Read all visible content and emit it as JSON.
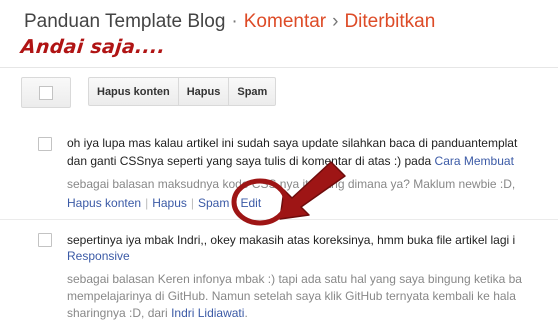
{
  "breadcrumb": {
    "root": "Panduan Template Blog",
    "sep": "·",
    "section": "Komentar",
    "sep2": "›",
    "current": "Diterbitkan"
  },
  "annotation_title": "Andai saja....",
  "toolbar": {
    "delete_content": "Hapus konten",
    "delete": "Hapus",
    "spam": "Spam"
  },
  "comments": [
    {
      "line1": "oh iya lupa mas kalau artikel ini sudah saya update silahkan baca di panduantemplat",
      "line2_text": "dan ganti CSSnya seperti yang saya tulis di komentar di atas :) pada ",
      "line2_link": "Cara Membuat",
      "reply_text": "sebagai balasan maksudnya kode CSS nya itu yang dimana ya? Maklum newbie :D,",
      "actions": [
        "Hapus konten",
        "Hapus",
        "Spam",
        "Edit"
      ]
    },
    {
      "line1": "sepertinya iya mbak Indri,, okey makasih atas koreksinya, hmm buka file artikel lagi i",
      "line2_link": "Responsive",
      "reply_line1": "sebagai balasan Keren infonya mbak :) tapi ada satu hal yang saya bingung ketika ba",
      "reply_line2": "mempelajarinya di GitHub. Namun setelah saya klik GitHub ternyata kembali ke hala",
      "reply_line3_text": "sharingnya :D, dari ",
      "reply_line3_link": "Indri Lidiawati",
      "reply_line3_end": "."
    }
  ],
  "colors": {
    "accent_orange": "#dd4b27",
    "annotation_red": "#9e1515",
    "link_blue": "#3b5aa6"
  }
}
